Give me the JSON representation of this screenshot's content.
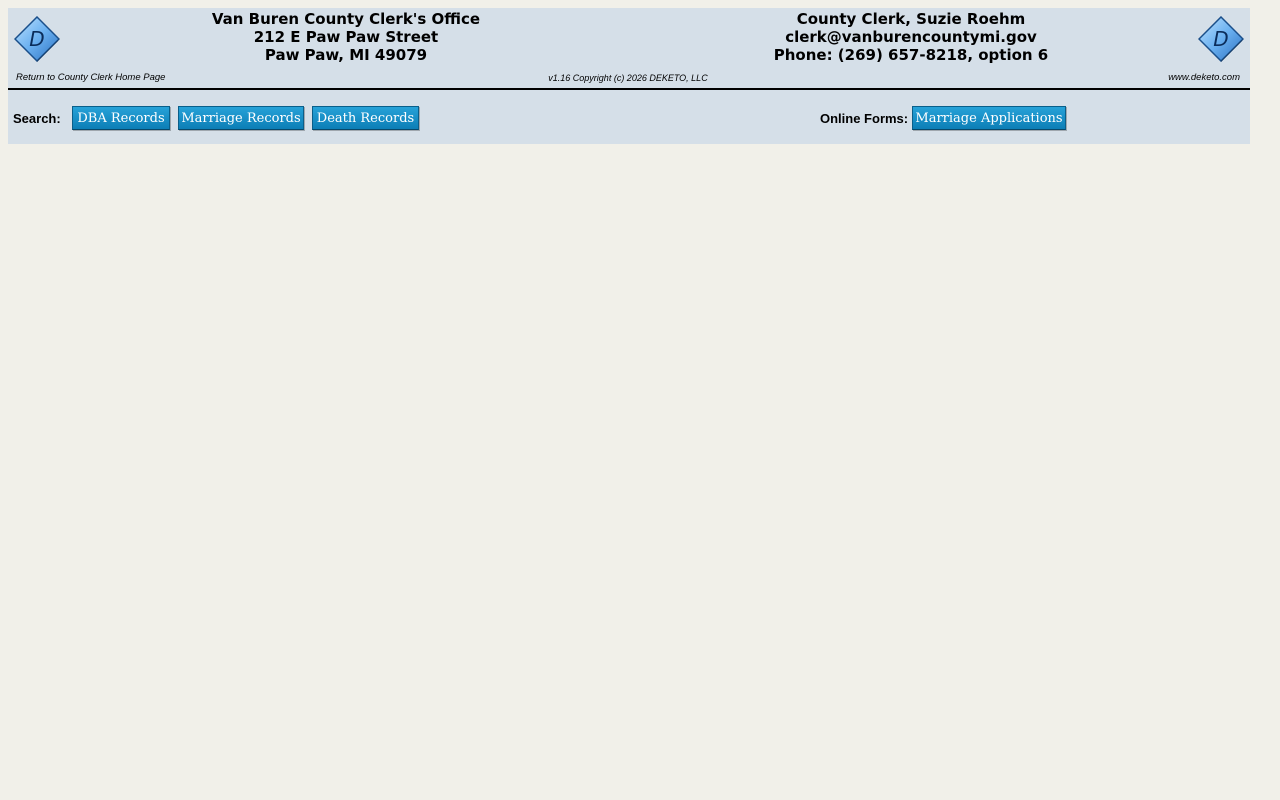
{
  "header": {
    "office": {
      "name": "Van Buren County Clerk's Office",
      "street": "212 E Paw Paw Street",
      "city": "Paw Paw, MI 49079"
    },
    "clerk": {
      "name": "County Clerk, Suzie Roehm",
      "email": "clerk@vanburencountymi.gov",
      "phone": "Phone: (269) 657-8218, option 6"
    },
    "home_link": "Return to County Clerk Home Page",
    "copyright": "v1.16 Copyright (c) 2026 DEKETO, LLC",
    "site_link": "www.deketo.com",
    "logo_letter": "D",
    "logo_icon": "deketo-diamond-logo"
  },
  "search": {
    "label": "Search:",
    "buttons": [
      "DBA Records",
      "Marriage Records",
      "Death Records"
    ]
  },
  "forms": {
    "label": "Online Forms:",
    "buttons": [
      "Marriage Applications"
    ]
  },
  "colors": {
    "page_bg": "#f1f0e9",
    "panel_bg": "#d5dfe8",
    "button_bg": "#1590c8",
    "logo_blue": "#6ab0f0"
  }
}
